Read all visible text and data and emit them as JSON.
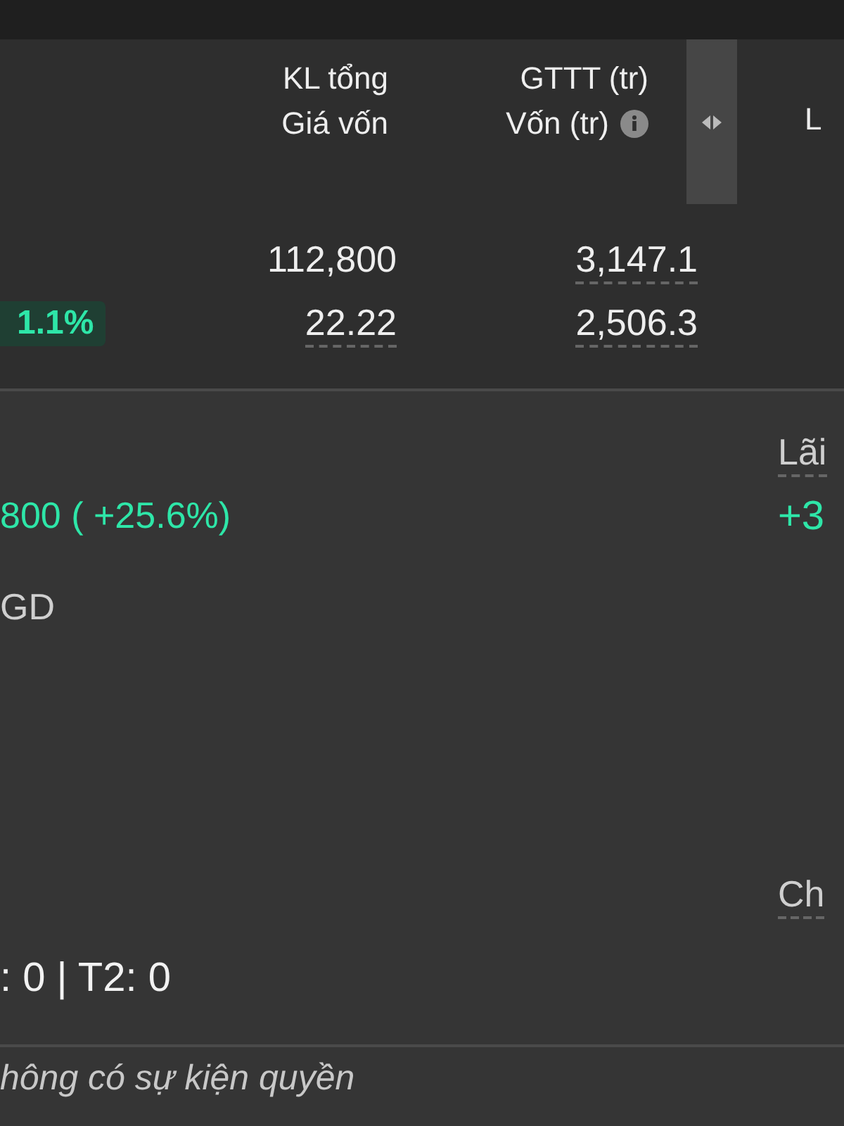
{
  "table": {
    "columns": [
      {
        "line1": "KL tổng",
        "line2": "Giá vốn",
        "info": false
      },
      {
        "line1": "GTTT (tr)",
        "line2": "Vốn (tr)",
        "info": true
      }
    ],
    "column_3": "L",
    "rows": [
      {
        "badge": "",
        "cells": [
          {
            "text": "112,800",
            "dashed": false
          },
          {
            "text": "3,147.1",
            "dashed": true
          }
        ]
      },
      {
        "badge": "1.1%",
        "cells": [
          {
            "text": "22.22",
            "dashed": true
          },
          {
            "text": "2,506.3",
            "dashed": true
          }
        ]
      }
    ]
  },
  "details": {
    "left": [
      {
        "text": "800 ( +25.6%)",
        "kind": "gain"
      },
      {
        "text": "GD",
        "kind": "label"
      },
      {
        "text": ": 0 | T2: 0",
        "kind": "value"
      }
    ],
    "right": [
      {
        "text": "Lãi",
        "kind": "label"
      },
      {
        "text": "+3",
        "kind": "gain"
      },
      {
        "text": "Ch",
        "kind": "label"
      }
    ]
  },
  "events_note": "hông có sự kiện quyền"
}
